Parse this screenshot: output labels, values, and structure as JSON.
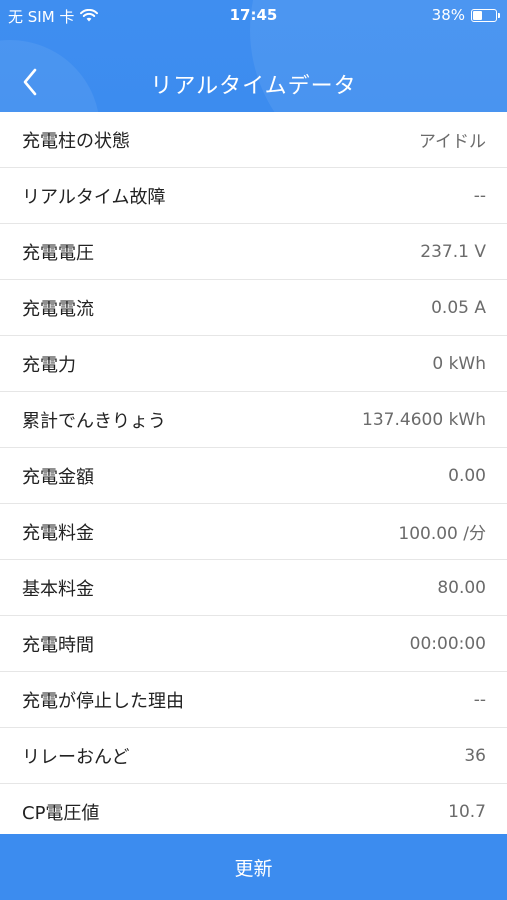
{
  "status_bar": {
    "carrier": "无 SIM 卡",
    "time": "17:45",
    "battery_percent": "38%",
    "battery_level": 0.38,
    "wifi_icon": "wifi-icon"
  },
  "nav": {
    "title": "リアルタイムデータ",
    "back_icon": "chevron-left-icon"
  },
  "rows": [
    {
      "label": "充電柱の状態",
      "value": "アイドル"
    },
    {
      "label": "リアルタイム故障",
      "value": "--"
    },
    {
      "label": "充電電圧",
      "value": "237.1 V"
    },
    {
      "label": "充電電流",
      "value": "0.05 A"
    },
    {
      "label": "充電力",
      "value": "0 kWh"
    },
    {
      "label": "累計でんきりょう",
      "value": "137.4600 kWh"
    },
    {
      "label": "充電金額",
      "value": "0.00"
    },
    {
      "label": "充電料金",
      "value": "100.00 /分"
    },
    {
      "label": "基本料金",
      "value": "80.00"
    },
    {
      "label": "充電時間",
      "value": "00:00:00"
    },
    {
      "label": "充電が停止した理由",
      "value": "--"
    },
    {
      "label": "リレーおんど",
      "value": "36"
    },
    {
      "label": "CP電圧値",
      "value": "10.7"
    }
  ],
  "footer": {
    "refresh_label": "更新"
  },
  "colors": {
    "primary": "#3c8cef",
    "label_text": "#222222",
    "value_text": "#6b6b6b",
    "divider": "#e6e6e6"
  }
}
